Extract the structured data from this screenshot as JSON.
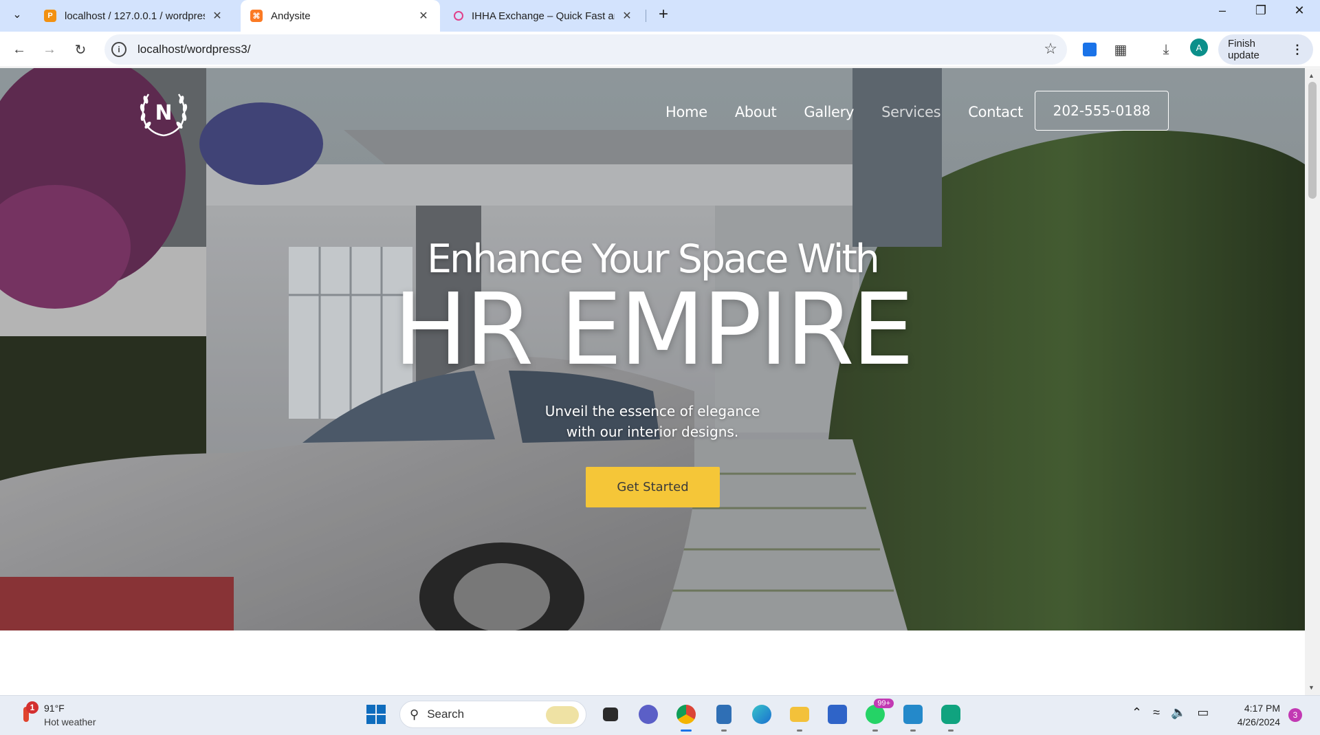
{
  "browser": {
    "tabs": [
      {
        "title": "localhost / 127.0.0.1 / wordpres",
        "favicon": "phpmyadmin-icon",
        "favicon_color": "#f29111",
        "active": false
      },
      {
        "title": "Andysite",
        "favicon": "xampp-icon",
        "favicon_color": "#fb7a24",
        "active": true
      },
      {
        "title": "IHHA Exchange – Quick Fast ar",
        "favicon": "ihha-icon",
        "favicon_color": "#e0408a",
        "active": false
      }
    ],
    "url": "localhost/wordpress3/",
    "profile_initial": "A",
    "finish_update_label": "Finish update"
  },
  "site": {
    "logo_letter": "N",
    "nav": [
      {
        "label": "Home"
      },
      {
        "label": "About"
      },
      {
        "label": "Gallery"
      },
      {
        "label": "Services"
      },
      {
        "label": "Contact"
      }
    ],
    "phone": "202-555-0188",
    "hero": {
      "subtitle": "Enhance Your Space With",
      "title": "HR EMPIRE",
      "description_line1": "Unveil the essence of elegance",
      "description_line2": "with our interior designs.",
      "cta_label": "Get Started"
    },
    "colors": {
      "cta": "#f5c638",
      "nav_text": "#ffffff"
    }
  },
  "taskbar": {
    "weather_temp": "91°F",
    "weather_condition": "Hot weather",
    "weather_badge": "1",
    "search_label": "Search",
    "whatsapp_badge": "99+",
    "time": "4:17 PM",
    "date": "4/26/2024",
    "notification_count": "3"
  }
}
